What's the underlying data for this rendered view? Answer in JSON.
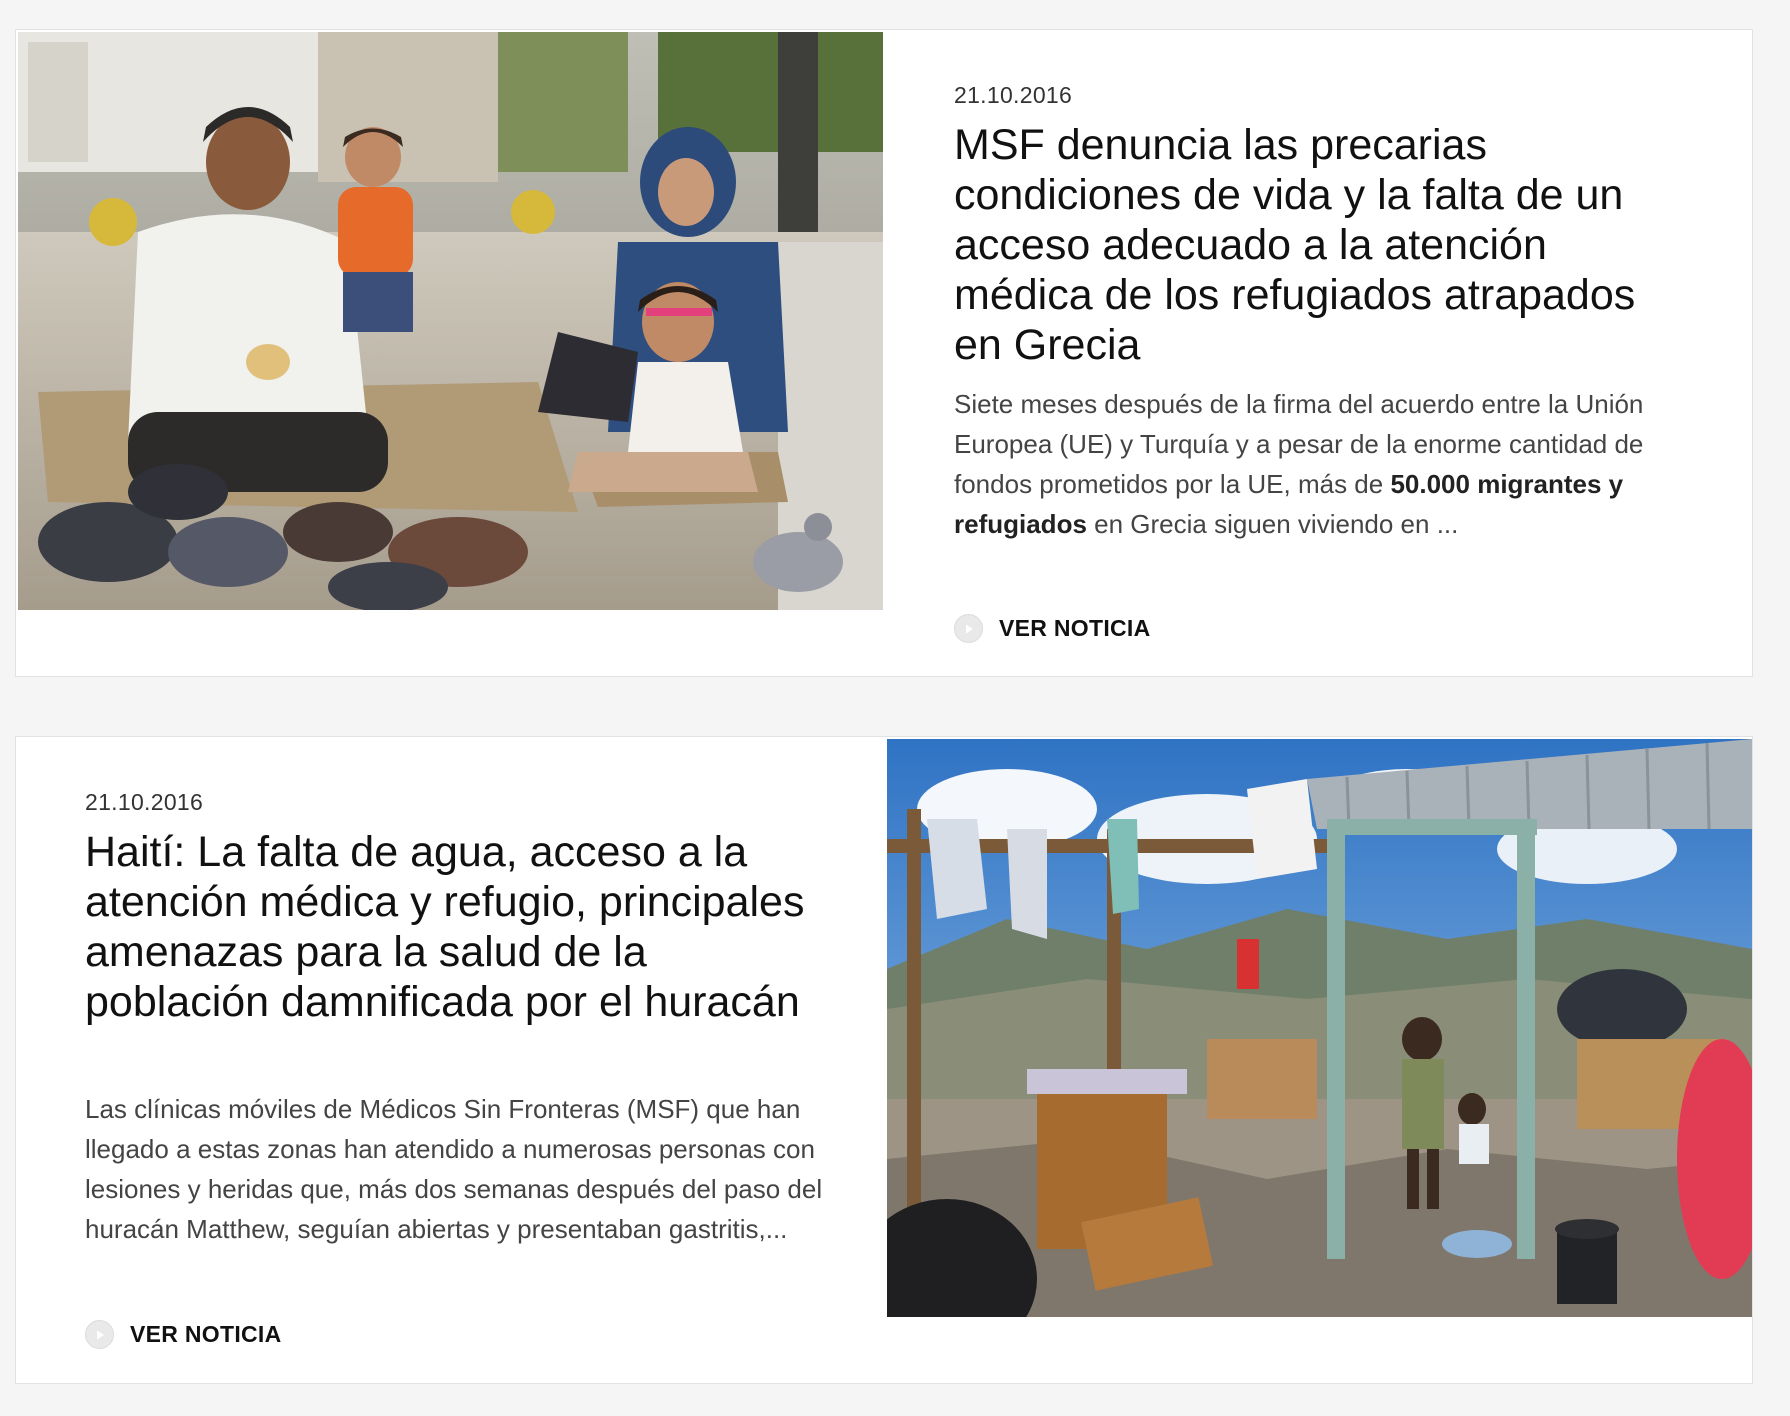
{
  "articles": [
    {
      "date": "21.10.2016",
      "title": "MSF denuncia las precarias condiciones de vida y la falta de un acceso adecuado a la atención médica de los refugiados atrapados en Grecia",
      "summary_before": "Siete meses después de la firma del acuerdo entre la Unión Europea (UE) y Turquía y a pesar de la enorme cantidad de fondos prometidos por la UE, más de ",
      "summary_bold": "50.000 migrantes y refugiados",
      "summary_after": " en Grecia siguen viviendo en ...",
      "cta_label": "VER NOTICIA",
      "cta_icon": "play-circle-icon",
      "image": "photo-refugee-family-with-pigeons"
    },
    {
      "date": "21.10.2016",
      "title": "Haití: La falta de agua, acceso a la atención médica y refugio, principales amenazas para la salud de la población damnificada por el huracán",
      "summary": "Las clínicas móviles de Médicos Sin Fronteras (MSF) que han llegado a estas zonas han atendido a numerosas personas con lesiones y heridas que, más dos semanas después del paso del huracán Matthew, seguían abiertas y presentaban gastritis,...",
      "cta_label": "VER NOTICIA",
      "cta_icon": "play-circle-icon",
      "image": "photo-hurricane-damaged-shelter"
    }
  ],
  "colors": {
    "page_background": "#f5f5f5",
    "card_background": "#ffffff",
    "text_primary": "#111111",
    "text_secondary": "#444444"
  }
}
